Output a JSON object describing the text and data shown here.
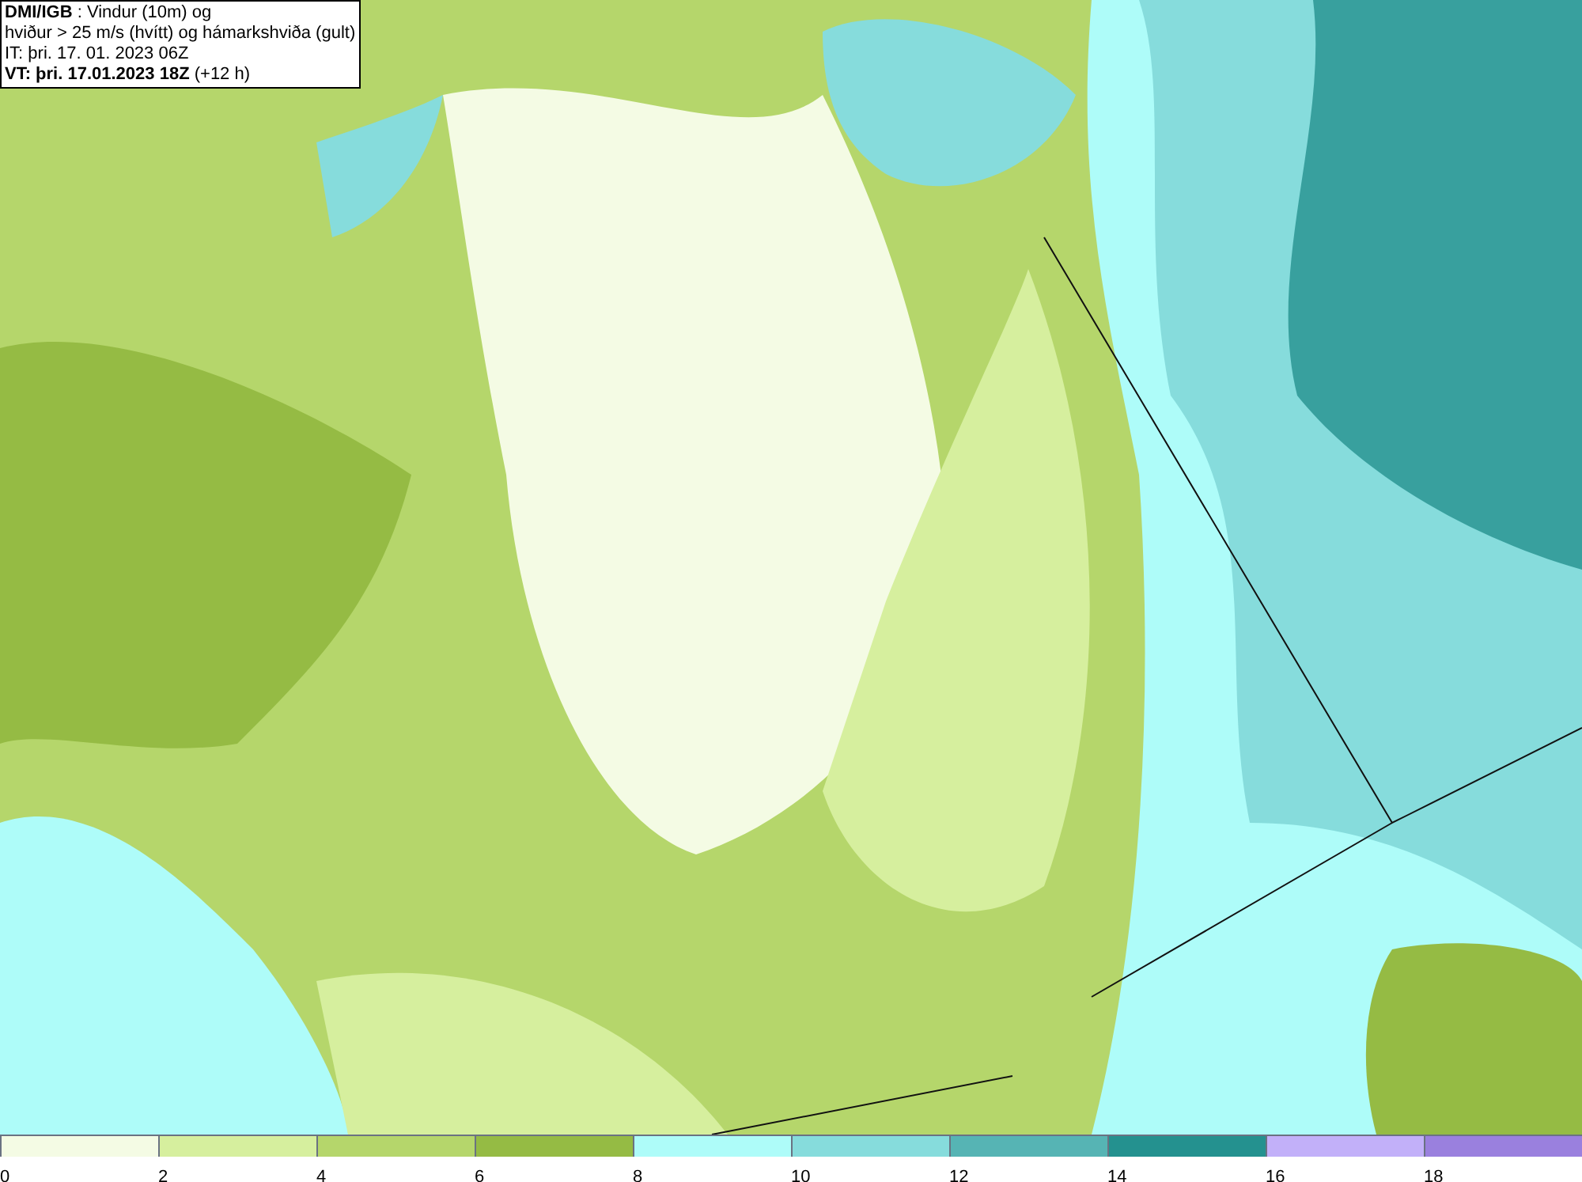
{
  "header": {
    "lines": [
      "**DMI/IGB** : Vindur (10m) og",
      "hviður > 25 m/s (hvítt) og hámarkshviða (gult)",
      "IT: þri. 17. 01. 2023 06Z",
      "**VT: þri. 17.01.2023 18Z** (+12 h)"
    ]
  },
  "legend": {
    "bins": [
      {
        "label": "0",
        "color": "#f4fbe4"
      },
      {
        "label": "2",
        "color": "#d6ef9e"
      },
      {
        "label": "4",
        "color": "#b5d66b"
      },
      {
        "label": "6",
        "color": "#95bb44"
      },
      {
        "label": "8",
        "color": "#aefcf9"
      },
      {
        "label": "10",
        "color": "#86dcdc"
      },
      {
        "label": "12",
        "color": "#56b4b4"
      },
      {
        "label": "14",
        "color": "#24918f"
      },
      {
        "label": "16",
        "color": "#c2b0f9"
      },
      {
        "label": "18",
        "color": "#9a80de"
      }
    ]
  }
}
